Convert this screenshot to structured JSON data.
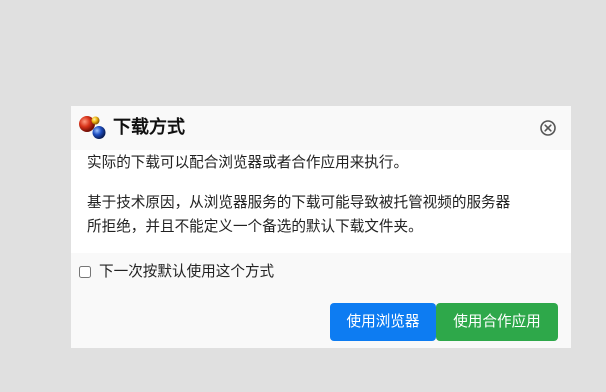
{
  "dialog": {
    "title": "下载方式",
    "app_icon": "colored-spheres-logo-icon",
    "close_icon": "circle-x-close-icon"
  },
  "message": {
    "line1": "实际的下载可以配合浏览器或者合作应用来执行。",
    "line2": "基于技术原因，从浏览器服务的下载可能导致被托管视频的服务器",
    "line3": "所拒绝，并且不能定义一个备选的默认下载文件夹。"
  },
  "remember": {
    "label": "下一次按默认使用这个方式",
    "checked": false
  },
  "buttons": {
    "use_browser": "使用浏览器",
    "use_helper_app": "使用合作应用"
  },
  "colors": {
    "background": "#e0e0e0",
    "dialog": "#f9f9f9",
    "panel": "#ffffff",
    "primary_button": "#0d7cf2",
    "success_button": "#2ea84a"
  }
}
